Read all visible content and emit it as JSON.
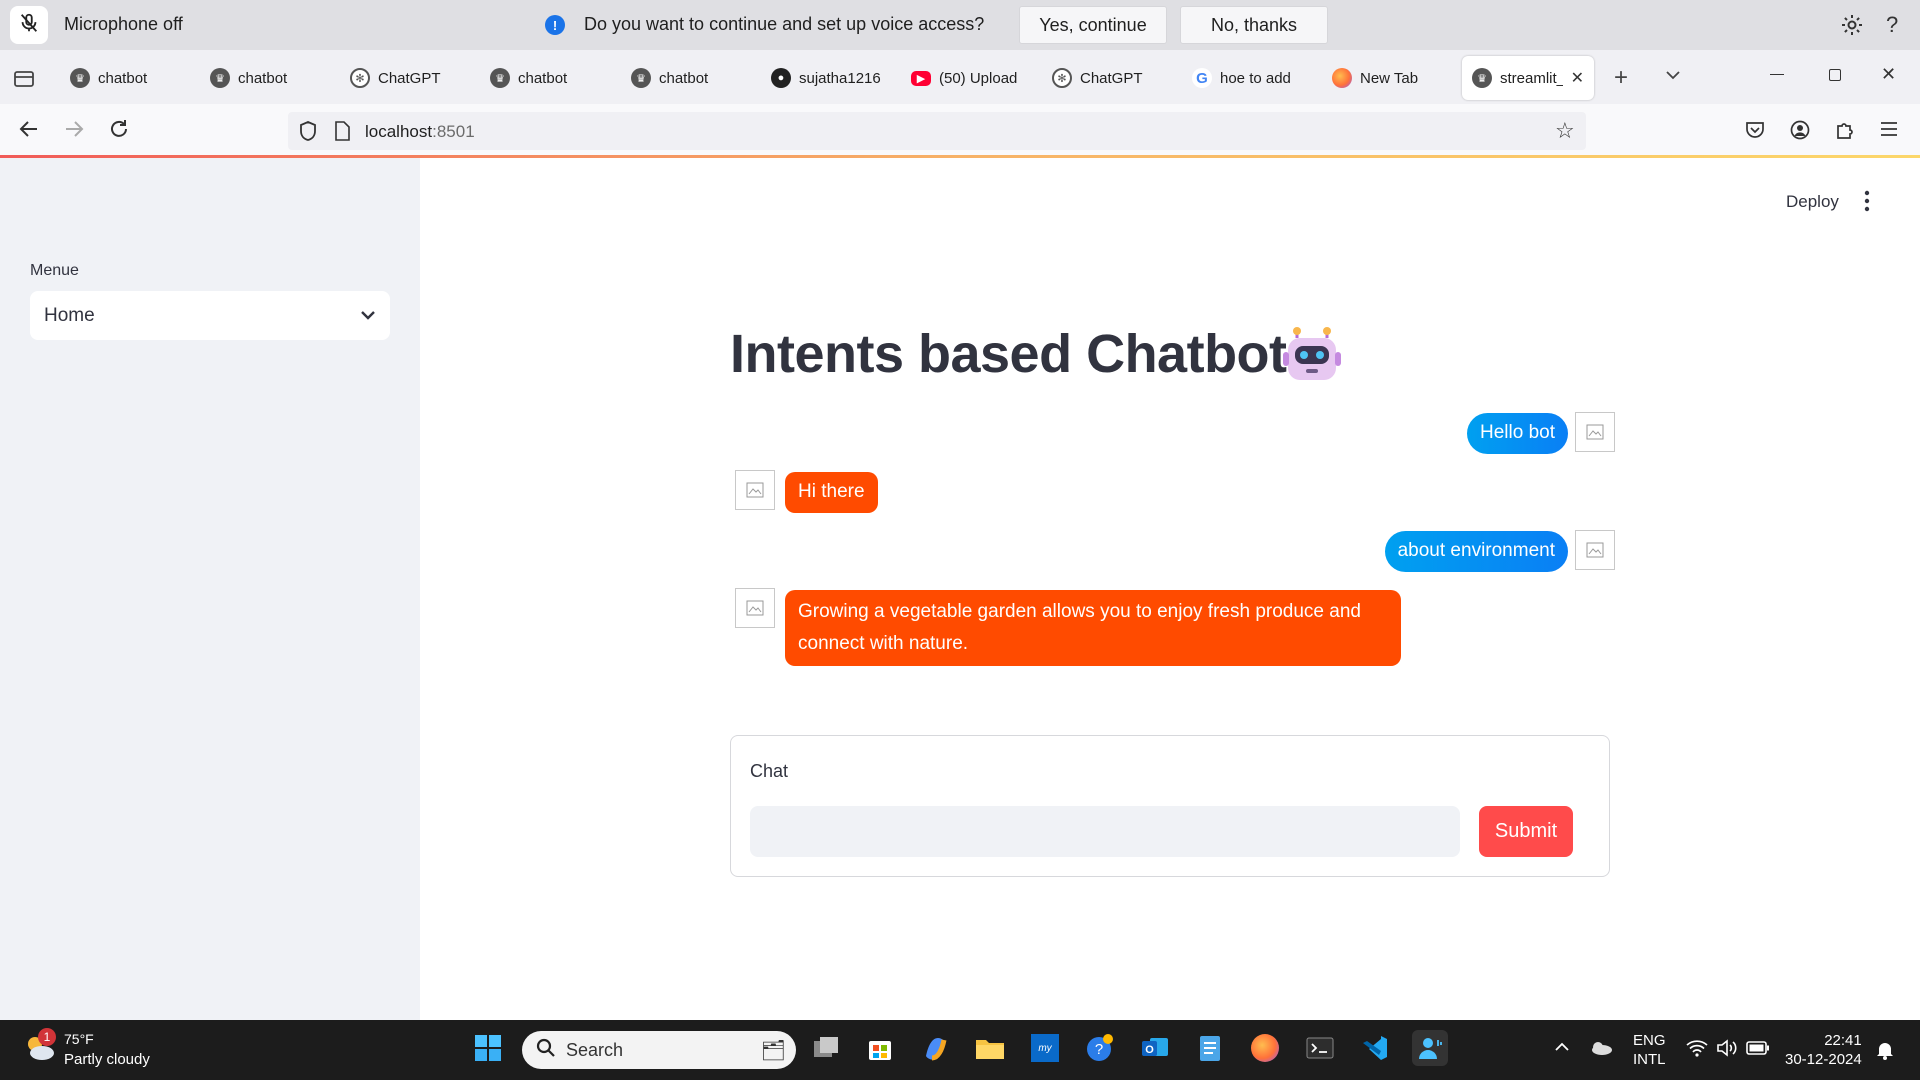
{
  "voice_bar": {
    "mic_status": "Microphone off",
    "prompt": "Do you want to continue and set up voice access?",
    "yes_label": "Yes, continue",
    "no_label": "No, thanks"
  },
  "browser": {
    "tabs": [
      {
        "label": "chatbot",
        "icon": "streamlit-crown"
      },
      {
        "label": "chatbot",
        "icon": "streamlit-crown"
      },
      {
        "label": "ChatGPT",
        "icon": "openai-logo"
      },
      {
        "label": "chatbot",
        "icon": "streamlit-crown"
      },
      {
        "label": "chatbot",
        "icon": "streamlit-crown"
      },
      {
        "label": "sujatha1216",
        "icon": "github-logo"
      },
      {
        "label": "(50) Upload",
        "icon": "youtube-logo"
      },
      {
        "label": "ChatGPT",
        "icon": "openai-logo"
      },
      {
        "label": "hoe to add",
        "icon": "google-logo"
      },
      {
        "label": "New Tab",
        "icon": "firefox-logo"
      },
      {
        "label": "streamlit_",
        "icon": "streamlit-crown",
        "active": true
      }
    ],
    "url_host": "localhost",
    "url_port": ":8501"
  },
  "app": {
    "sidebar": {
      "menu_label": "Menue",
      "selected_page": "Home"
    },
    "deploy_label": "Deploy",
    "title": "Intents based Chatbot",
    "title_emoji": "robot-face",
    "messages": [
      {
        "role": "user",
        "text": "Hello bot"
      },
      {
        "role": "bot",
        "text": "Hi there"
      },
      {
        "role": "user",
        "text": "about environment"
      },
      {
        "role": "bot",
        "text": "Growing a vegetable garden allows you to enjoy fresh produce and connect with nature."
      }
    ],
    "form": {
      "label": "Chat",
      "input_value": "",
      "submit_label": "Submit"
    },
    "colors": {
      "user_bubble": "#0a8ff5",
      "bot_bubble": "#ff4b00",
      "submit": "#ff4b4b",
      "sidebar_bg": "#f0f2f6"
    }
  },
  "taskbar": {
    "weather_temp": "75°F",
    "weather_desc": "Partly cloudy",
    "weather_badge": "1",
    "search_placeholder": "Search",
    "lang_top": "ENG",
    "lang_bottom": "INTL",
    "time": "22:41",
    "date": "30-12-2024"
  }
}
